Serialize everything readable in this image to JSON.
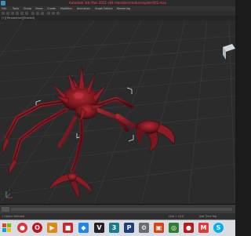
{
  "window": {
    "title": "Autodesk 3ds Max 2011 x64     monster/creature/spider002.max"
  },
  "menu": {
    "items": [
      "Edit",
      "Tools",
      "Group",
      "Views",
      "Create",
      "Modifiers",
      "Animation",
      "Graph Editors",
      "Rendering"
    ]
  },
  "viewport_label": "[+][Perspective][Shaded]",
  "status": {
    "left": "1 Object Selected",
    "grid": "Grid = 10.0",
    "keys": "Add Time Tag"
  },
  "timeline": {
    "position": 0
  },
  "taskbar": {
    "icons": [
      "windows-start-icon",
      "chrome-icon",
      "opera-icon",
      "media-player-icon",
      "bookmark-icon",
      "paint-icon",
      "v-app-icon",
      "3dsmax-icon",
      "photoshop-icon",
      "settings-icon",
      "gallery-icon",
      "network-icon",
      "vray-icon",
      "maxscript-icon",
      "skype-icon"
    ]
  },
  "colors": {
    "creature": "#8e1c24",
    "grid": "#3c3c3c",
    "background": "#2b2b2b",
    "title_text": "#ff4a4a"
  }
}
